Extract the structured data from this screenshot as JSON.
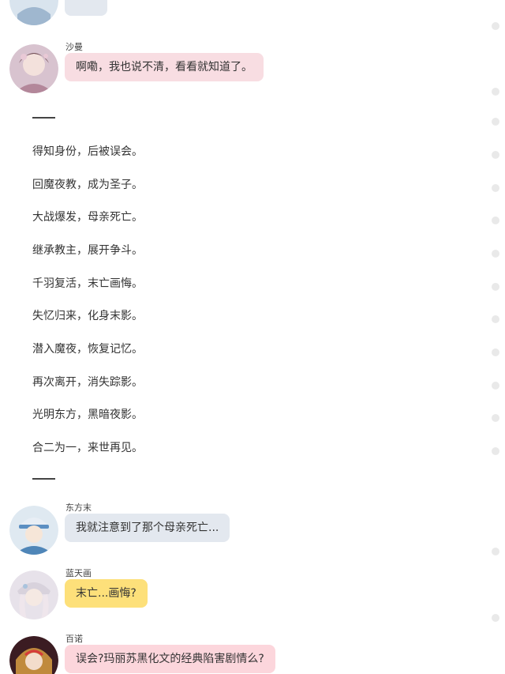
{
  "messages": [
    {
      "sender": "沙曼",
      "text": "啊嘞，我也说不清，看看就知道了。"
    },
    {
      "sender": "东方末",
      "text": "我就注意到了那个母亲死亡..."
    },
    {
      "sender": "蓝天画",
      "text": "末亡...画悔?"
    },
    {
      "sender": "百诺",
      "text": "误会?玛丽苏黑化文的经典陷害剧情么?"
    }
  ],
  "story": {
    "divider": "——",
    "lines": [
      "得知身份，后被误会。",
      "回魔夜教，成为圣子。",
      "大战爆发，母亲死亡。",
      "继承教主，展开争斗。",
      "千羽复活，末亡画悔。",
      "失忆归来，化身末影。",
      "潜入魔夜，恢复记忆。",
      "再次离开，消失踪影。",
      "光明东方，黑暗夜影。",
      "合二为一，来世再见。"
    ]
  },
  "colors": {
    "bubble_pink": "#f8dde2",
    "bubble_blue": "#e3e8ef",
    "bubble_yellow": "#fde07a",
    "bubble_pink_light": "#fcd6dc"
  }
}
